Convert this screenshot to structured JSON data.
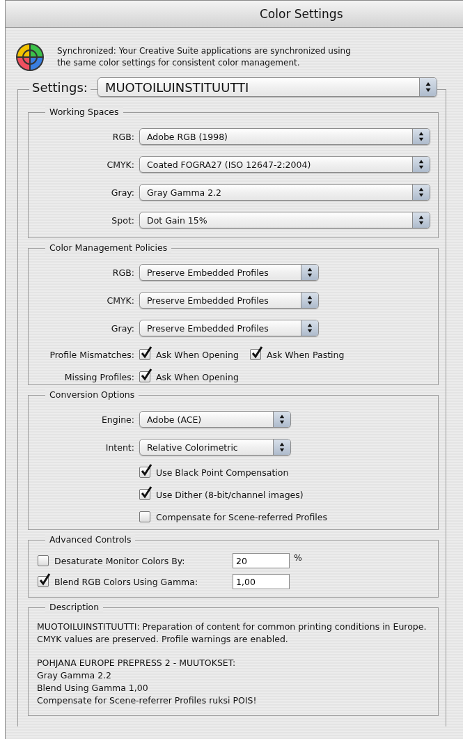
{
  "window": {
    "title": "Color Settings"
  },
  "sync_message": "Synchronized: Your Creative Suite applications are synchronized using the same color settings for consistent color management.",
  "settings": {
    "label": "Settings:",
    "value": "MUOTOILUINSTITUUTTI"
  },
  "working_spaces": {
    "title": "Working Spaces",
    "rows": [
      {
        "label": "RGB:",
        "value": "Adobe RGB (1998)"
      },
      {
        "label": "CMYK:",
        "value": "Coated FOGRA27 (ISO 12647-2:2004)"
      },
      {
        "label": "Gray:",
        "value": "Gray Gamma 2.2"
      },
      {
        "label": "Spot:",
        "value": "Dot Gain 15%"
      }
    ]
  },
  "policies": {
    "title": "Color Management Policies",
    "rows": [
      {
        "label": "RGB:",
        "value": "Preserve Embedded Profiles"
      },
      {
        "label": "CMYK:",
        "value": "Preserve Embedded Profiles"
      },
      {
        "label": "Gray:",
        "value": "Preserve Embedded Profiles"
      }
    ],
    "check_rows": [
      {
        "label": "Profile Mismatches:",
        "checks": [
          {
            "label": "Ask When Opening",
            "checked": true
          },
          {
            "label": "Ask When Pasting",
            "checked": true
          }
        ]
      },
      {
        "label": "Missing Profiles:",
        "checks": [
          {
            "label": "Ask When Opening",
            "checked": true
          }
        ]
      }
    ]
  },
  "conversion": {
    "title": "Conversion Options",
    "rows": [
      {
        "label": "Engine:",
        "value": "Adobe (ACE)"
      },
      {
        "label": "Intent:",
        "value": "Relative Colorimetric"
      }
    ],
    "checks": [
      {
        "label": "Use Black Point Compensation",
        "checked": true
      },
      {
        "label": "Use Dither (8-bit/channel images)",
        "checked": true
      },
      {
        "label": "Compensate for Scene-referred Profiles",
        "checked": false
      }
    ]
  },
  "advanced": {
    "title": "Advanced Controls",
    "rows": [
      {
        "label": "Desaturate Monitor Colors By:",
        "checked": false,
        "value": "20",
        "unit": "%"
      },
      {
        "label": "Blend RGB Colors Using Gamma:",
        "checked": true,
        "value": "1,00"
      }
    ]
  },
  "description": {
    "title": "Description",
    "paragraphs": [
      [
        "MUOTOILUINSTITUUTTI:  Preparation of content for common printing conditions in Europe. CMYK values are preserved. Profile warnings are enabled."
      ],
      [
        "POHJANA EUROPE PREPRESS 2 - MUUTOKSET:",
        "Gray Gamma 2.2",
        "Blend Using Gamma 1,00",
        "Compensate for Scene-referrer Profiles ruksi POIS!"
      ]
    ]
  }
}
